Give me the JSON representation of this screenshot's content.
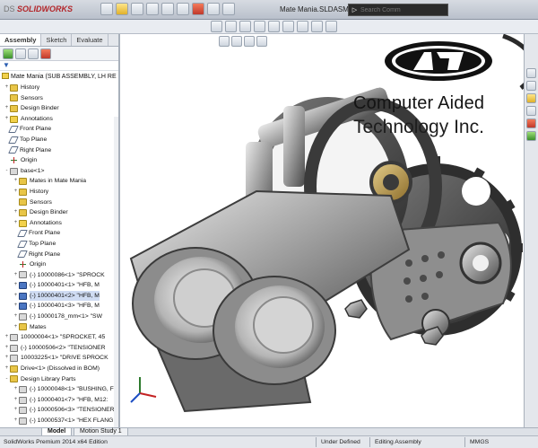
{
  "app": {
    "logo": "SOLIDWORKS",
    "logo_prefix": "DS",
    "document_title": "Mate Mania.SLDASM *",
    "search_placeholder": "Search Comm"
  },
  "feature_manager": {
    "tabs": [
      {
        "label": "Assembly",
        "active": true
      },
      {
        "label": "Sketch",
        "active": false
      },
      {
        "label": "Evaluate",
        "active": false
      }
    ],
    "root": "Mate Mania  (SUB ASSEMBLY, LH RE",
    "items": [
      {
        "label": "History",
        "icon": "folder",
        "exp": "+"
      },
      {
        "label": "Sensors",
        "icon": "folder",
        "exp": ""
      },
      {
        "label": "Design Binder",
        "icon": "folder",
        "exp": "+"
      },
      {
        "label": "Annotations",
        "icon": "yellow",
        "exp": "+"
      },
      {
        "label": "Front Plane",
        "icon": "plane",
        "exp": ""
      },
      {
        "label": "Top Plane",
        "icon": "plane",
        "exp": ""
      },
      {
        "label": "Right Plane",
        "icon": "plane",
        "exp": ""
      },
      {
        "label": "Origin",
        "icon": "origin",
        "exp": ""
      },
      {
        "label": "base<1>",
        "icon": "part",
        "exp": "-"
      },
      {
        "label": "Mates in Mate Mania",
        "icon": "folder",
        "exp": "+"
      },
      {
        "label": "History",
        "icon": "folder",
        "exp": "+"
      },
      {
        "label": "Sensors",
        "icon": "folder",
        "exp": ""
      },
      {
        "label": "Design Binder",
        "icon": "folder",
        "exp": "+"
      },
      {
        "label": "Annotations",
        "icon": "yellow",
        "exp": "+"
      },
      {
        "label": "Front Plane",
        "icon": "plane",
        "exp": ""
      },
      {
        "label": "Top Plane",
        "icon": "plane",
        "exp": ""
      },
      {
        "label": "Right Plane",
        "icon": "plane",
        "exp": ""
      },
      {
        "label": "Origin",
        "icon": "origin",
        "exp": ""
      },
      {
        "label": "(-) 10000086<1> \"SPROCK",
        "icon": "part",
        "exp": "+"
      },
      {
        "label": "(-) 10000401<1> \"HFB, M",
        "icon": "sel",
        "exp": "+"
      },
      {
        "label": "(-) 10000401<2> \"HFB, M",
        "icon": "sel",
        "exp": "+",
        "selected": true
      },
      {
        "label": "(-) 10000401<3> \"HFB, M",
        "icon": "sel",
        "exp": "+"
      },
      {
        "label": "(-) 10000178_mm<1> \"SW",
        "icon": "part",
        "exp": "+"
      },
      {
        "label": "Mates",
        "icon": "folder",
        "exp": "+"
      },
      {
        "label": "10000004<1> \"SPROCKET, 45",
        "icon": "part",
        "exp": "+"
      },
      {
        "label": "(-) 10000506<2> \"TENSIONER",
        "icon": "part",
        "exp": "+"
      },
      {
        "label": "10003225<1> \"DRIVE SPROCK",
        "icon": "part",
        "exp": "+"
      },
      {
        "label": "Drive<1> (Dissolved in BOM)",
        "icon": "folder",
        "exp": "+"
      },
      {
        "label": "Design Library Parts",
        "icon": "folder",
        "exp": "-"
      },
      {
        "label": "(-) 10000048<1> \"BUSHING, F",
        "icon": "part",
        "exp": "+"
      },
      {
        "label": "(-) 10000401<7> \"HFB, M12:",
        "icon": "part",
        "exp": "+"
      },
      {
        "label": "(-) 10000506<3> \"TENSIONER",
        "icon": "part",
        "exp": "+"
      },
      {
        "label": "(-) 10000537<1> \"HEX FLANG",
        "icon": "part",
        "exp": "+"
      }
    ]
  },
  "overlay": {
    "company_line1": "Computer Aided",
    "company_line2": "Technology Inc.",
    "logo_letters": "CAT"
  },
  "bottom_tabs": [
    {
      "label": "Model",
      "active": true
    },
    {
      "label": "Motion Study 1",
      "active": false
    }
  ],
  "status": {
    "edition": "SolidWorks Premium 2014 x64 Edition",
    "state": "Under Defined",
    "mode": "Editing Assembly",
    "units": "MMGS"
  },
  "colors": {
    "accent": "#2a5db0",
    "logo_red": "#b3262a"
  }
}
